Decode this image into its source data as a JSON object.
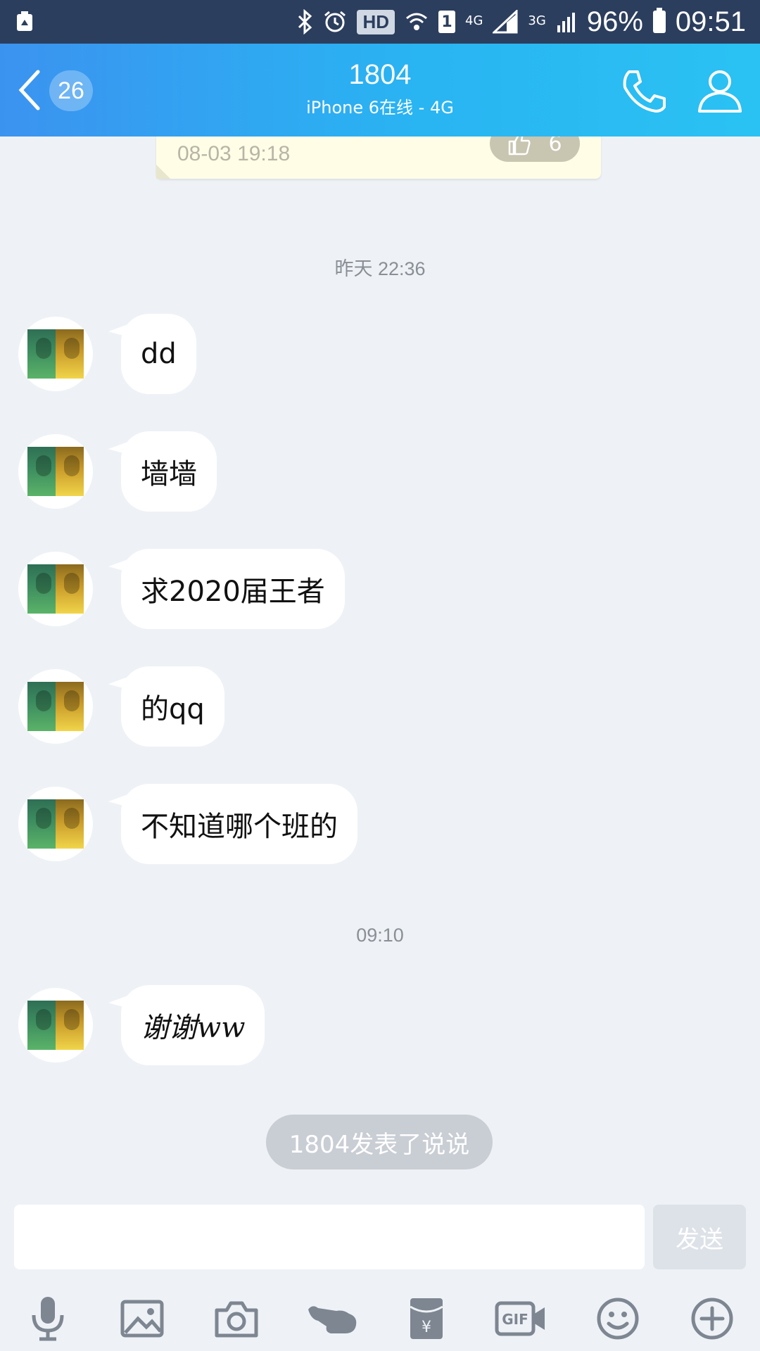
{
  "status_bar": {
    "hd": "HD",
    "sim": "1",
    "net1": "4G",
    "net2": "3G",
    "battery": "96%",
    "time": "09:51",
    "icons": [
      "recycle-icon",
      "bluetooth-icon",
      "alarm-icon",
      "wifi-icon",
      "signal-icon",
      "battery-icon"
    ]
  },
  "header": {
    "back_icon": "chevron-left-icon",
    "unread_count": "26",
    "title": "1804",
    "subtitle": "iPhone 6在线 - 4G",
    "actions": [
      "phone-icon",
      "profile-icon"
    ]
  },
  "note_card": {
    "time": "08-03 19:18",
    "likes": "6"
  },
  "timestamps": {
    "first": "昨天 22:36",
    "second": "09:10"
  },
  "messages": [
    {
      "text": "dd"
    },
    {
      "text": "墙墙"
    },
    {
      "text": "求2020届王者"
    },
    {
      "text": "的qq"
    },
    {
      "text": "不知道哪个班的"
    },
    {
      "text": "谢谢ww"
    }
  ],
  "system_notice": "1804发表了说说",
  "composer": {
    "placeholder": "",
    "send_label": "发送"
  },
  "toolbar": [
    "microphone-icon",
    "image-icon",
    "camera-icon",
    "poke-icon",
    "red-packet-icon",
    "gif-icon",
    "emoji-icon",
    "plus-icon"
  ],
  "colors": {
    "header_start": "#3b93f0",
    "header_end": "#2ac2f3",
    "status_bar": "#2c3e5e",
    "background": "#eef2f6",
    "bubble": "#ffffff"
  }
}
